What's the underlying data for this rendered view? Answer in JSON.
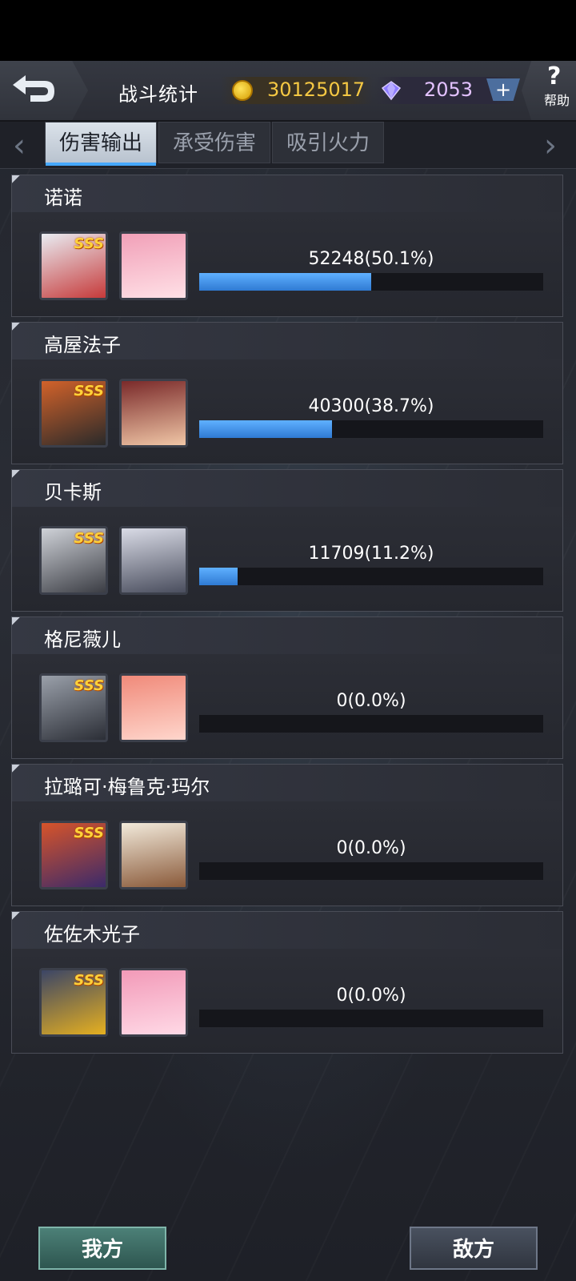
{
  "header": {
    "title": "战斗统计",
    "gold": "30125017",
    "gems": "2053",
    "plus_label": "+",
    "help_q": "?",
    "help_label": "帮助"
  },
  "tabs": [
    {
      "label": "伤害输出",
      "active": true
    },
    {
      "label": "承受伤害",
      "active": false
    },
    {
      "label": "吸引火力",
      "active": false
    }
  ],
  "pilots": [
    {
      "name": "诺诺",
      "stat": "52248(50.1%)",
      "fraction": 0.501,
      "rank": "SSS"
    },
    {
      "name": "高屋法子",
      "stat": "40300(38.7%)",
      "fraction": 0.387,
      "rank": "SSS"
    },
    {
      "name": "贝卡斯",
      "stat": "11709(11.2%)",
      "fraction": 0.112,
      "rank": "SSS"
    },
    {
      "name": "格尼薇儿",
      "stat": "0(0.0%)",
      "fraction": 0.0,
      "rank": "SSS"
    },
    {
      "name": "拉璐可·梅鲁克·玛尔",
      "stat": "0(0.0%)",
      "fraction": 0.0,
      "rank": "SSS"
    },
    {
      "name": "佐佐木光子",
      "stat": "0(0.0%)",
      "fraction": 0.0,
      "rank": "SSS"
    }
  ],
  "footer": {
    "ours_label": "我方",
    "enemy_label": "敌方"
  },
  "colors": {
    "bar": "#3f8fe6",
    "gold": "#f5c843",
    "gem": "#e3c2ff"
  }
}
